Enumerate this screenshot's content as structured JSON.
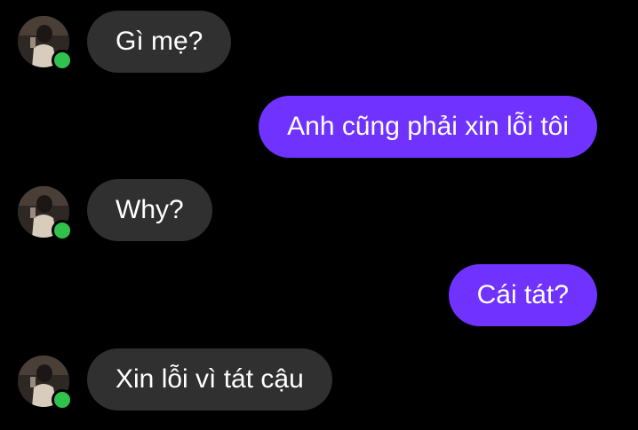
{
  "theme": {
    "background": "#000000",
    "incoming_bubble": "#303030",
    "outgoing_bubble": "#7033ff",
    "text": "#ffffff",
    "presence": "#31c24d"
  },
  "messages": [
    {
      "direction": "incoming",
      "text": "Gì mẹ?",
      "avatar": "contact-avatar",
      "online": true
    },
    {
      "direction": "outgoing",
      "text": "Anh cũng phải xin lỗi tôi"
    },
    {
      "direction": "incoming",
      "text": "Why?",
      "avatar": "contact-avatar",
      "online": true
    },
    {
      "direction": "outgoing",
      "text": "Cái tát?"
    },
    {
      "direction": "incoming",
      "text": "Xin lỗi vì tát cậu",
      "avatar": "contact-avatar",
      "online": true
    }
  ]
}
